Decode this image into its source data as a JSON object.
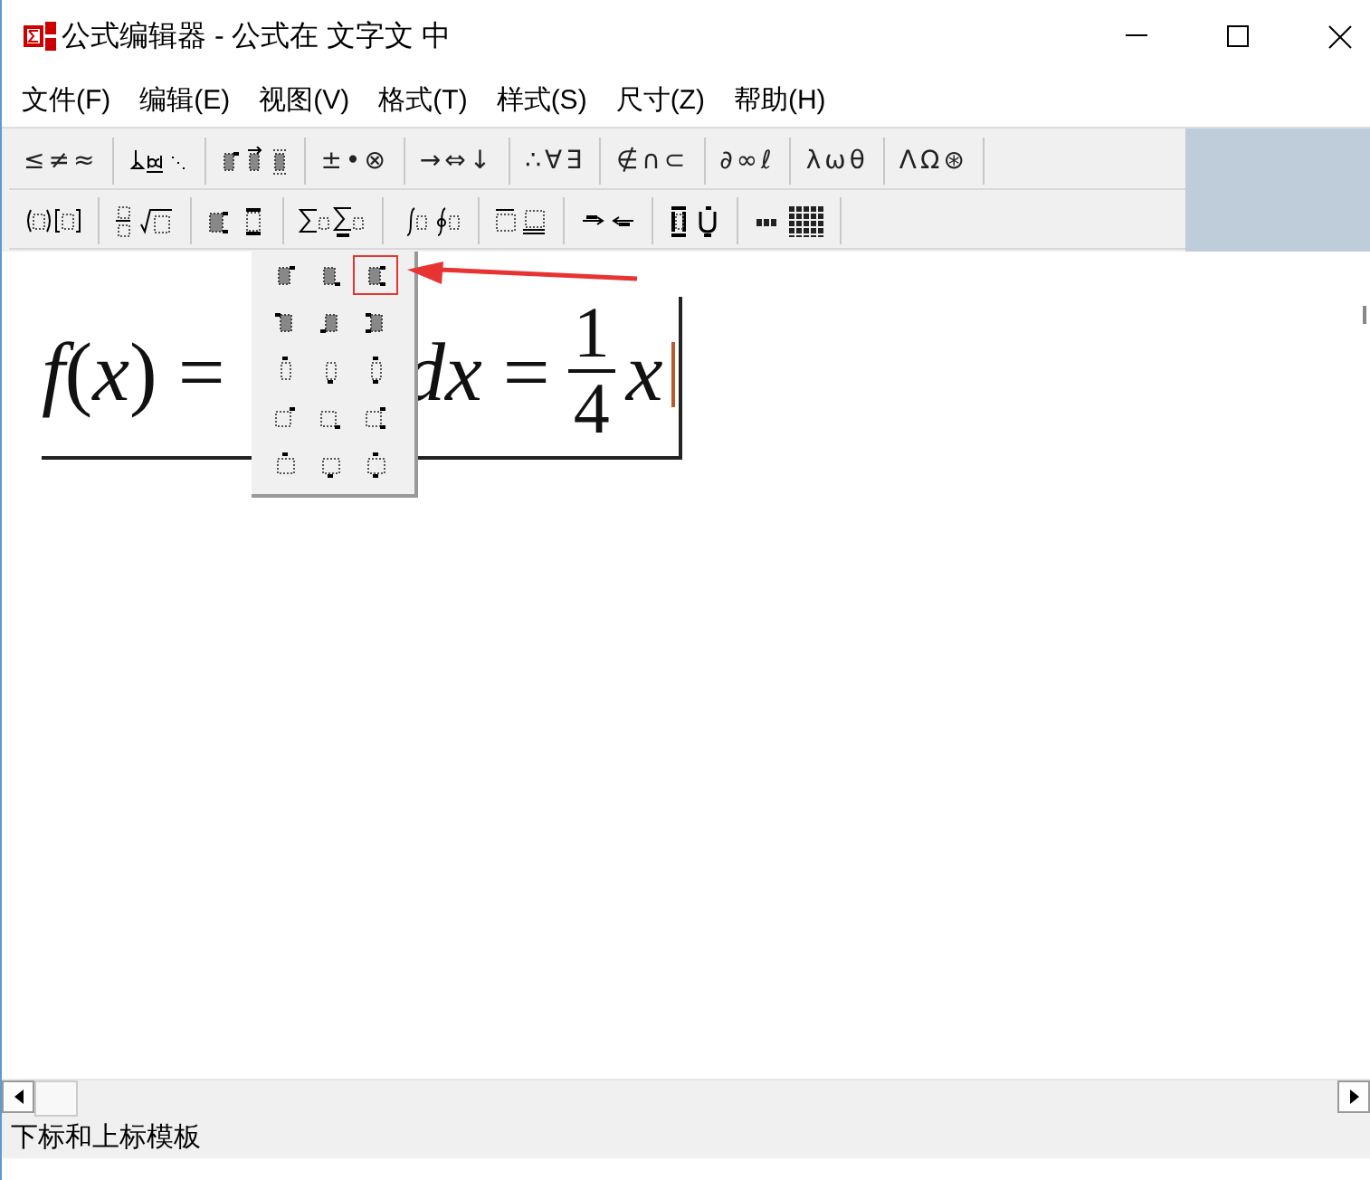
{
  "window": {
    "title": "公式编辑器 - 公式在 文字文 中"
  },
  "menu": [
    "文件(F)",
    "编辑(E)",
    "视图(V)",
    "格式(T)",
    "样式(S)",
    "尺寸(Z)",
    "帮助(H)"
  ],
  "toolbar": [
    [
      {
        "kind": "symbols",
        "label": "≤≠≈"
      },
      {
        "kind": "template"
      },
      {
        "kind": "template"
      },
      {
        "kind": "symbols",
        "label": "±•⊗"
      },
      {
        "kind": "symbols",
        "label": "→⇔↓"
      },
      {
        "kind": "symbols",
        "label": "∴∀∃"
      },
      {
        "kind": "symbols",
        "label": "∉∩⊂"
      },
      {
        "kind": "symbols",
        "label": "∂∞ℓ"
      },
      {
        "kind": "symbols",
        "label": "λωθ"
      },
      {
        "kind": "symbols",
        "label": "ΛΩ⊛"
      }
    ],
    [
      {
        "kind": "template"
      },
      {
        "kind": "template"
      },
      {
        "kind": "template"
      },
      {
        "kind": "template"
      },
      {
        "kind": "template"
      },
      {
        "kind": "template"
      },
      {
        "kind": "template"
      },
      {
        "kind": "template"
      },
      {
        "kind": "template"
      }
    ]
  ],
  "equation": {
    "left": "*f*(*x*) =",
    "right": "*dx* =",
    "fraction": {
      "numerator": "1",
      "denominator": "4"
    },
    "tail": "*x*"
  },
  "popup": {
    "items": [
      {
        "selected": false
      },
      {
        "selected": false
      },
      {
        "selected": true
      },
      {
        "selected": false
      },
      {
        "selected": false
      },
      {
        "selected": false
      },
      {
        "selected": false
      },
      {
        "selected": false
      },
      {
        "selected": false
      },
      {
        "selected": false
      },
      {
        "selected": false
      },
      {
        "selected": false
      },
      {
        "selected": false
      },
      {
        "selected": false
      },
      {
        "selected": false
      }
    ]
  },
  "status_bar": "下标和上标模板"
}
